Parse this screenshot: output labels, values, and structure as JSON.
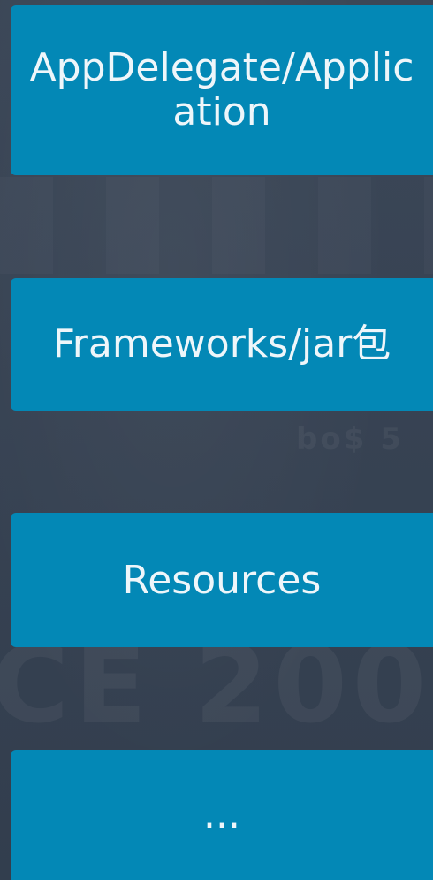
{
  "boxes": [
    {
      "label": "AppDelegate/Application"
    },
    {
      "label": "Frameworks/jar包"
    },
    {
      "label": "Resources"
    },
    {
      "label": "..."
    }
  ],
  "background": {
    "color": "#354152",
    "watermark_large": "CE 200",
    "watermark_small": "bo$ 5"
  },
  "colors": {
    "box_fill": "#0388b6",
    "box_text": "#eef6fa"
  }
}
